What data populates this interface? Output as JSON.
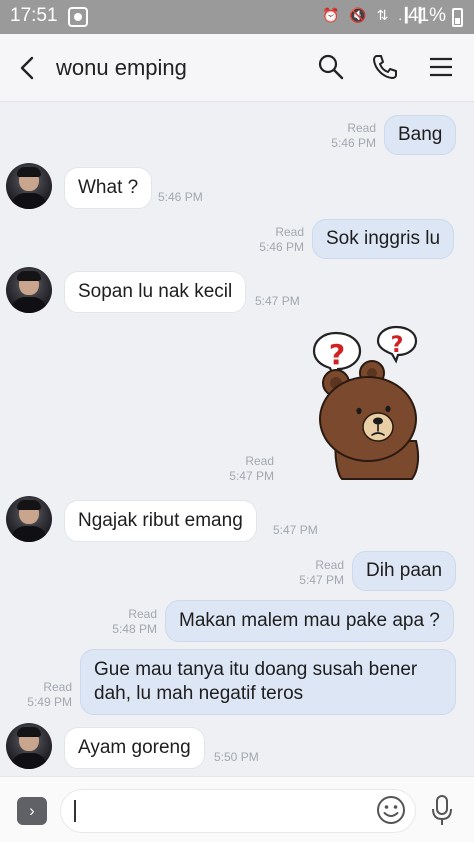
{
  "status_bar": {
    "time": "17:51",
    "icons": "⏰ 🔇 ⇅ .▎▎",
    "battery": "41%"
  },
  "header": {
    "title": "wonu emping",
    "back_icon": "chevron-left-icon",
    "search_icon": "search-icon",
    "call_icon": "phone-icon",
    "menu_icon": "menu-icon"
  },
  "messages": [
    {
      "side": "out",
      "text": "Bang",
      "read": "Read",
      "time": "5:46 PM"
    },
    {
      "side": "in",
      "text": "What ?",
      "time": "5:46 PM"
    },
    {
      "side": "out",
      "text": "Sok inggris lu",
      "read": "Read",
      "time": "5:46 PM"
    },
    {
      "side": "in",
      "text": "Sopan lu nak kecil",
      "time": "5:47 PM"
    },
    {
      "side": "out",
      "type": "sticker",
      "sticker": "brown-bear-confused-sticker",
      "read": "Read",
      "time": "5:47 PM"
    },
    {
      "side": "in",
      "text": "Ngajak ribut emang",
      "time": "5:47 PM"
    },
    {
      "side": "out",
      "text": "Dih paan",
      "read": "Read",
      "time": "5:47 PM"
    },
    {
      "side": "out",
      "text": "Makan malem mau pake apa ?",
      "read": "Read",
      "time": "5:48 PM"
    },
    {
      "side": "out",
      "text": "Gue mau tanya itu doang susah bener dah, lu mah negatif teros",
      "read": "Read",
      "time": "5:49 PM"
    },
    {
      "side": "in",
      "text": "Ayam goreng",
      "time": "5:50 PM"
    }
  ],
  "composer": {
    "expand_icon": "chevron-right-icon",
    "value": "",
    "emoji_icon": "emoji-icon",
    "mic_icon": "microphone-icon"
  },
  "colors": {
    "out_bubble": "#dde6f5",
    "in_bubble": "#ffffff",
    "background": "#eef0f4",
    "status_bar": "#9a9a9a"
  }
}
